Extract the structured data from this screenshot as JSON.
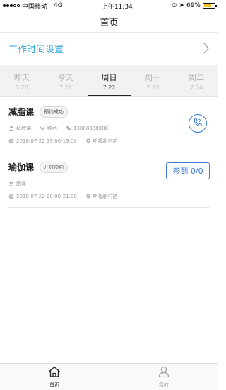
{
  "status_bar": {
    "carrier": "中国移动",
    "network": "4G",
    "time": "上午11:34",
    "battery_percent": "69%",
    "battery_level": 0.69
  },
  "nav": {
    "title": "首页"
  },
  "worktime": {
    "label": "工作时间设置"
  },
  "day_tabs": [
    {
      "name": "昨天",
      "date": "7.20"
    },
    {
      "name": "今天",
      "date": "7.21"
    },
    {
      "name": "周日",
      "date": "7.22"
    },
    {
      "name": "周一",
      "date": "7.23"
    },
    {
      "name": "周二",
      "date": "7.24"
    }
  ],
  "active_day_index": 2,
  "courses": [
    {
      "title": "减脂课",
      "tag": "预约成功",
      "coach_type": "私教课",
      "member": "鸭西",
      "phone": "13888888888",
      "time": "2018-07-22 19:00-19:00",
      "location": "听福新村店"
    },
    {
      "title": "瑜伽课",
      "tag": "开放预约",
      "coach_type": "团课",
      "time": "2018-07-22 20:00-21:00",
      "location": "听福新村店",
      "signin_label": "签到 0/0"
    }
  ],
  "tabbar": {
    "home_label": "首页",
    "mine_label": "我的"
  },
  "colors": {
    "accent": "#3a7bd5",
    "worktime_text": "#2aa0d8",
    "battery": "#f3c11f"
  }
}
